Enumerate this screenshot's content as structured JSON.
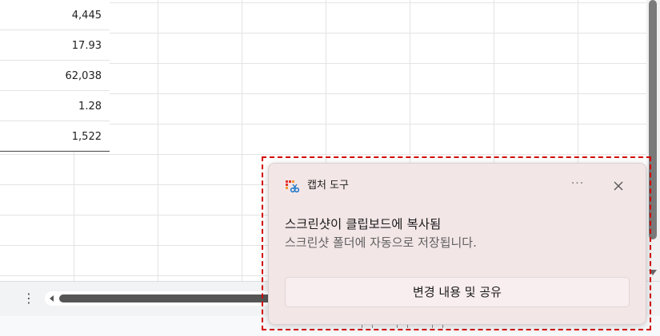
{
  "spreadsheet": {
    "values": [
      "4,445",
      "17.93",
      "62,038",
      "1.28",
      "1,522"
    ]
  },
  "toolbar": {
    "more_icon": "vertical-ellipsis-icon"
  },
  "toast": {
    "app_name": "캡처 도구",
    "more_label": "···",
    "title": "스크린샷이 클립보드에 복사됨",
    "subtitle": "스크린샷 폴더에 자동으로 저장됩니다.",
    "action_label": "변경 내용 및 공유",
    "accent_color": "#d40000",
    "background_color": "#f3e6e7"
  }
}
